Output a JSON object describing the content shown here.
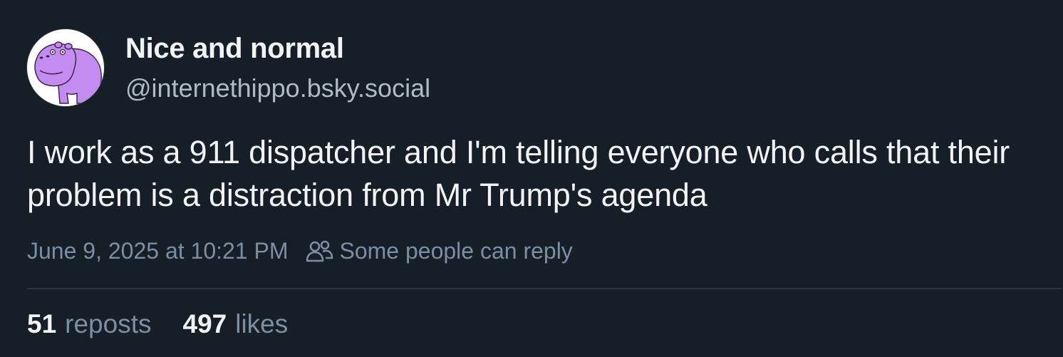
{
  "author": {
    "display_name": "Nice and normal",
    "handle": "@internethippo.bsky.social",
    "avatar_icon": "hippo-avatar-icon",
    "avatar_color": "#c48cf0"
  },
  "post": {
    "text": "I work as a 911 dispatcher and I'm telling everyone who calls that their problem is a distraction from Mr Trump's agenda"
  },
  "meta": {
    "timestamp": "June 9, 2025 at 10:21 PM",
    "reply_icon": "people-icon",
    "reply_setting": "Some people can reply"
  },
  "stats": {
    "reposts_count": "51",
    "reposts_label": "reposts",
    "likes_count": "497",
    "likes_label": "likes"
  },
  "colors": {
    "background": "#161e27",
    "text_primary": "#f1f3f5",
    "text_secondary": "#7b8ea3",
    "divider": "#2a3541"
  }
}
